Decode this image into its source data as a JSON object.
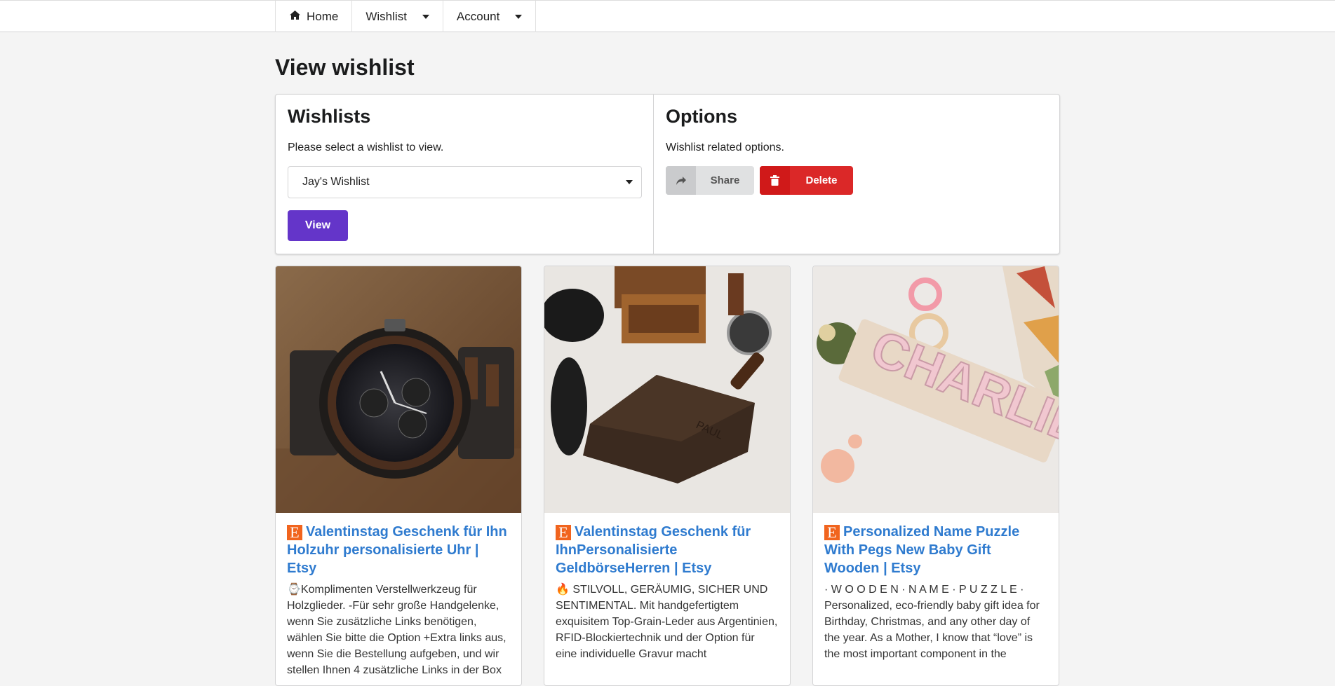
{
  "nav": {
    "home": "Home",
    "wishlist": "Wishlist",
    "account": "Account"
  },
  "page": {
    "title": "View wishlist"
  },
  "wishlists": {
    "heading": "Wishlists",
    "instruction": "Please select a wishlist to view.",
    "selected": "Jay's Wishlist",
    "view_label": "View"
  },
  "options": {
    "heading": "Options",
    "description": "Wishlist related options.",
    "share_label": "Share",
    "delete_label": "Delete"
  },
  "cards": [
    {
      "title": "Valentinstag Geschenk für Ihn Holzuhr personalisierte Uhr | Etsy",
      "description": "⌚Komplimenten Verstellwerkzeug für Holzglieder. -Für sehr große Handgelenke, wenn Sie zusätzliche Links benötigen, wählen Sie bitte die Option +Extra links aus, wenn Sie die Bestellung aufgeben, und wir stellen Ihnen 4 zusätzliche Links in der Box"
    },
    {
      "title": "Valentinstag Geschenk für IhnPersonalisierte GeldbörseHerren | Etsy",
      "description": "🔥 STILVOLL, GERÄUMIG, SICHER UND SENTIMENTAL. Mit handgefertigtem exquisitem Top-Grain-Leder aus Argentinien, RFID-Blockiertechnik und der Option für eine individuelle Gravur macht"
    },
    {
      "title": "Personalized Name Puzzle With Pegs New Baby Gift Wooden | Etsy",
      "description": "· W O O D E N · N A M E · P U Z Z L E · Personalized, eco-friendly baby gift idea for Birthday, Christmas, and any other day of the year. As a Mother, I know that “love” is the most important component in the"
    }
  ],
  "colors": {
    "primary": "#6435c9",
    "danger": "#db2828",
    "link": "#2f7bcf",
    "etsy": "#f1641e"
  },
  "icons": [
    "home-icon",
    "share-icon",
    "trash-icon",
    "etsy-icon"
  ]
}
